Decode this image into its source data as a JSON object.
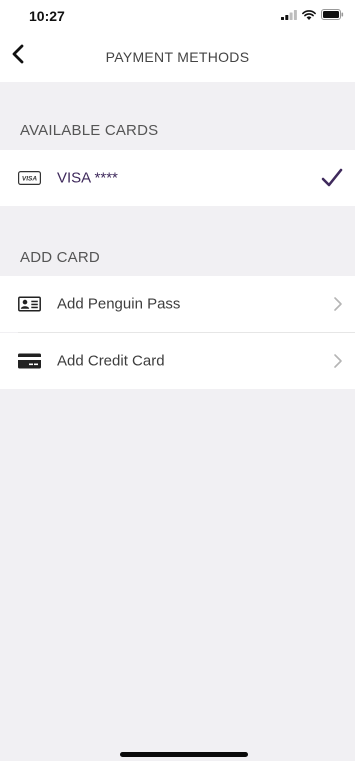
{
  "status_bar": {
    "time": "10:27",
    "signal_icon": "cellular-signal-icon",
    "wifi_icon": "wifi-icon",
    "battery_icon": "battery-icon"
  },
  "nav": {
    "back_icon": "chevron-left-icon",
    "title": "PAYMENT METHODS"
  },
  "available_cards": {
    "header": "AVAILABLE CARDS",
    "items": [
      {
        "icon": "visa-card-icon",
        "icon_text": "VISA",
        "label": "VISA ****",
        "selected_icon": "checkmark-icon"
      }
    ]
  },
  "add_card": {
    "header": "ADD CARD",
    "items": [
      {
        "icon": "id-card-icon",
        "label": "Add Penguin Pass",
        "action_icon": "chevron-right-icon"
      },
      {
        "icon": "credit-card-icon",
        "label": "Add Credit Card",
        "action_icon": "chevron-right-icon"
      }
    ]
  },
  "colors": {
    "accent": "#3f2a5c",
    "background": "#f1f0f3",
    "surface": "#ffffff"
  }
}
